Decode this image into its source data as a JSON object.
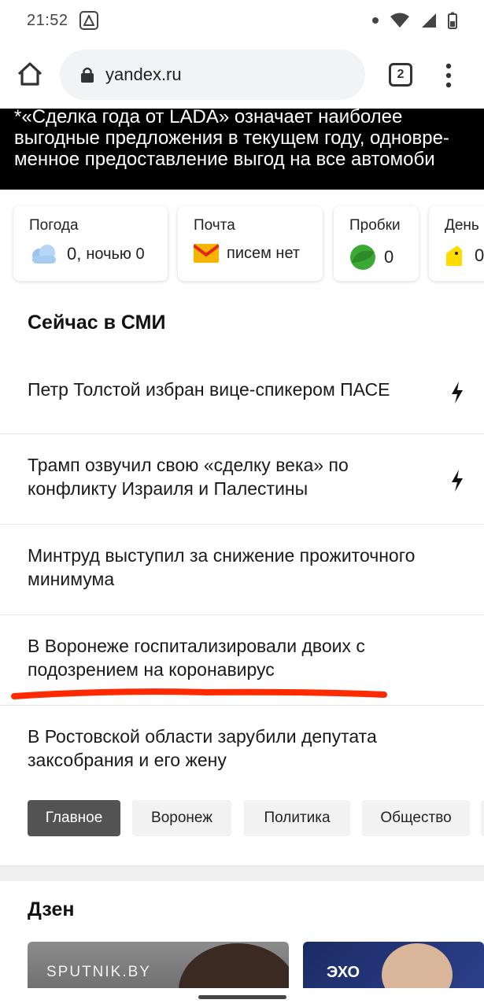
{
  "status_bar": {
    "time": "21:52"
  },
  "browser": {
    "url": "yandex.ru",
    "tab_count": "2"
  },
  "ad": {
    "line1": "*«Сделка года от LADA» означает наиболее",
    "line2": "выгодные предложения в текущем году, одновре-",
    "line3": "менное предоставление выгод на все автомоби"
  },
  "informers": [
    {
      "title": "Погода",
      "value": "0,",
      "extra": "ночью 0",
      "icon": "cloud-icon"
    },
    {
      "title": "Почта",
      "value": "писем нет",
      "icon": "mail-envelope-icon"
    },
    {
      "title": "Пробки",
      "value": "0",
      "icon": "traffic-green-icon"
    },
    {
      "title": "День",
      "value": "0",
      "icon": "wallet-icon"
    }
  ],
  "news": {
    "title": "Сейчас в СМИ",
    "items": [
      {
        "text": "Петр Толстой избран вице-спикером ПАСЕ",
        "flash": true
      },
      {
        "text": "Трамп озвучил свою «сделку века» по конфликту Израиля и Палестины",
        "flash": true
      },
      {
        "text": "Минтруд выступил за снижение прожиточного минимума",
        "flash": false
      },
      {
        "text": "В Воронеже госпитализировали двоих с подозрением на коронавирус",
        "flash": false
      },
      {
        "text": "В Ростовской области зарубили депутата заксобрания и его жену",
        "flash": false
      }
    ],
    "rubrics": [
      {
        "label": "Главное",
        "active": true
      },
      {
        "label": "Воронеж",
        "active": false
      },
      {
        "label": "Политика",
        "active": false
      },
      {
        "label": "Общество",
        "active": false
      }
    ]
  },
  "zen": {
    "title": "Дзен",
    "cards": [
      {
        "source": "SPUTNIK.BY"
      },
      {
        "source": "ЭХО"
      }
    ]
  },
  "colors": {
    "highlight_mark": "#ff2a00",
    "rubric_active_bg": "#535353",
    "mail_envelope": "#f5b400",
    "traffic_green": "#3aaa35"
  }
}
